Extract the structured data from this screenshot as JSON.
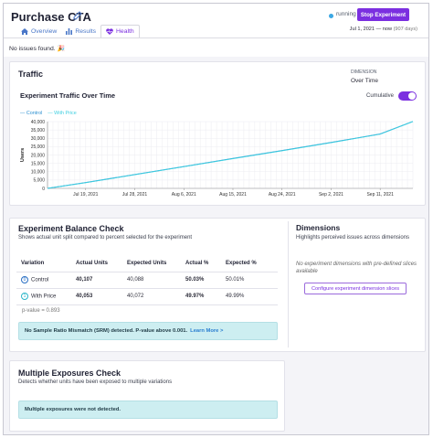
{
  "header": {
    "title": "Purchase CTA",
    "status": "running",
    "stop_label": "Stop Experiment",
    "date_range": "Jul 1, 2021 — now",
    "date_days": "(907 days)"
  },
  "tabs": [
    {
      "label": "Overview",
      "icon": "home-icon"
    },
    {
      "label": "Results",
      "icon": "chart-bars-icon"
    },
    {
      "label": "Health",
      "icon": "heartbeat-icon"
    }
  ],
  "no_issues": "No issues found. 🎉",
  "traffic": {
    "title": "Traffic",
    "dimension_label": "DIMENSION",
    "dimension_value": "Over Time",
    "chart_title": "Experiment Traffic Over Time",
    "cumulative_label": "Cumulative",
    "cumulative_on": true
  },
  "chart_data": {
    "type": "line",
    "title": "Experiment Traffic Over Time",
    "xlabel": "",
    "ylabel": "Users",
    "x_ticks": [
      "Jul 19, 2021",
      "Jul 28, 2021",
      "Aug 6, 2021",
      "Aug 15, 2021",
      "Aug 24, 2021",
      "Sep 2, 2021",
      "Sep 11, 2021"
    ],
    "y_ticks": [
      "0",
      "5,000",
      "10,000",
      "15,000",
      "20,000",
      "25,000",
      "30,000",
      "35,000",
      "40,000"
    ],
    "ylim": [
      0,
      40000
    ],
    "grid": true,
    "legend": "top-left",
    "x": [
      "Jul 12, 2021",
      "Jul 19, 2021",
      "Jul 28, 2021",
      "Aug 6, 2021",
      "Aug 15, 2021",
      "Aug 24, 2021",
      "Sep 2, 2021",
      "Sep 11, 2021",
      "Sep 17, 2021"
    ],
    "series": [
      {
        "name": "Control",
        "color": "#2a8fd0",
        "values": [
          0,
          3500,
          8300,
          13100,
          17900,
          22700,
          27500,
          32600,
          40100
        ]
      },
      {
        "name": "With Price",
        "color": "#3ecfe0",
        "values": [
          0,
          3400,
          8200,
          13000,
          17800,
          22500,
          27400,
          32500,
          40050
        ]
      }
    ]
  },
  "balance": {
    "title": "Experiment Balance Check",
    "subtitle": "Shows actual unit split compared to percent selected for the experiment",
    "columns": [
      "Variation",
      "Actual Units",
      "Expected Units",
      "Actual %",
      "Expected %"
    ],
    "rows": [
      {
        "badge": "0",
        "variation": "Control",
        "actual_units": "40,107",
        "expected_units": "40,088",
        "actual_pct": "50.03%",
        "expected_pct": "50.01%"
      },
      {
        "badge": "1",
        "variation": "With Price",
        "actual_units": "40,053",
        "expected_units": "40,072",
        "actual_pct": "49.97%",
        "expected_pct": "49.99%"
      }
    ],
    "p_value": "p-value = 0.893",
    "srm_message": "No Sample Ratio Mismatch (SRM) detected. P-value above 0.001.",
    "srm_link": "Learn More >"
  },
  "dimensions": {
    "title": "Dimensions",
    "subtitle": "Highlights perceived issues across dimensions",
    "empty_message": "No experiment dimensions with pre-defined slices available",
    "configure_label": "Configure experiment dimension slices"
  },
  "exposures": {
    "title": "Multiple Exposures Check",
    "subtitle": "Detects whether units have been exposed to multiple variations",
    "message": "Multiple exposures were not detected."
  },
  "colors": {
    "accent": "#7b2fe0",
    "control": "#2a8fd0",
    "with_price": "#3ecfe0",
    "info_bg": "#cdeef1"
  }
}
